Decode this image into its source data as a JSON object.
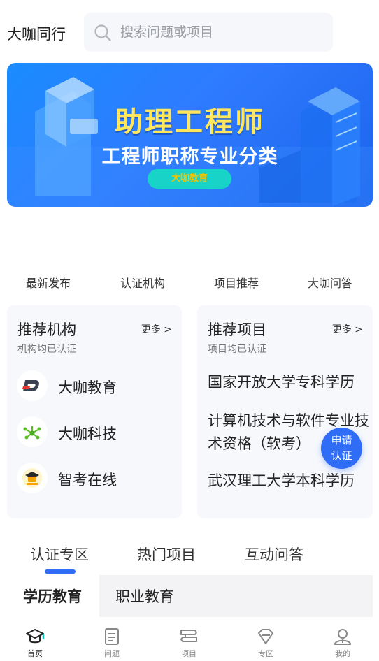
{
  "header": {
    "brand": "大咖同行",
    "search_placeholder": "搜索问题或项目"
  },
  "banner": {
    "title": "助理工程师",
    "subtitle": "工程师职称专业分类",
    "badge": "大咖教育"
  },
  "quick_nav": [
    "最新发布",
    "认证机构",
    "项目推荐",
    "大咖问答"
  ],
  "orgs_card": {
    "title": "推荐机构",
    "subtitle": "机构均已认证",
    "more": "更多 >",
    "items": [
      {
        "name": "大咖教育",
        "icon": "daka-education-logo"
      },
      {
        "name": "大咖科技",
        "icon": "daka-tech-logo"
      },
      {
        "name": "智考在线",
        "icon": "zhikao-online-logo"
      }
    ]
  },
  "projects_card": {
    "title": "推荐项目",
    "subtitle": "项目均已认证",
    "more": "更多 >",
    "items": [
      "国家开放大学专科学历",
      "计算机技术与软件专业技术资格（软考）",
      "武汉理工大学本科学历"
    ]
  },
  "fab": {
    "line1": "申请",
    "line2": "认证"
  },
  "tabs": {
    "items": [
      "认证专区",
      "热门项目",
      "互动问答"
    ],
    "active": 0
  },
  "subtabs": {
    "items": [
      "学历教育",
      "职业教育"
    ],
    "active": 0
  },
  "bottom_nav": {
    "items": [
      {
        "label": "首页",
        "icon": "graduation-cap-icon"
      },
      {
        "label": "问题",
        "icon": "document-icon"
      },
      {
        "label": "项目",
        "icon": "project-icon"
      },
      {
        "label": "专区",
        "icon": "diamond-icon"
      },
      {
        "label": "我的",
        "icon": "user-icon"
      }
    ],
    "active": 0
  },
  "colors": {
    "accent": "#2f6df6",
    "banner_title": "#ffe65a",
    "card_bg": "#f6f8fc"
  }
}
